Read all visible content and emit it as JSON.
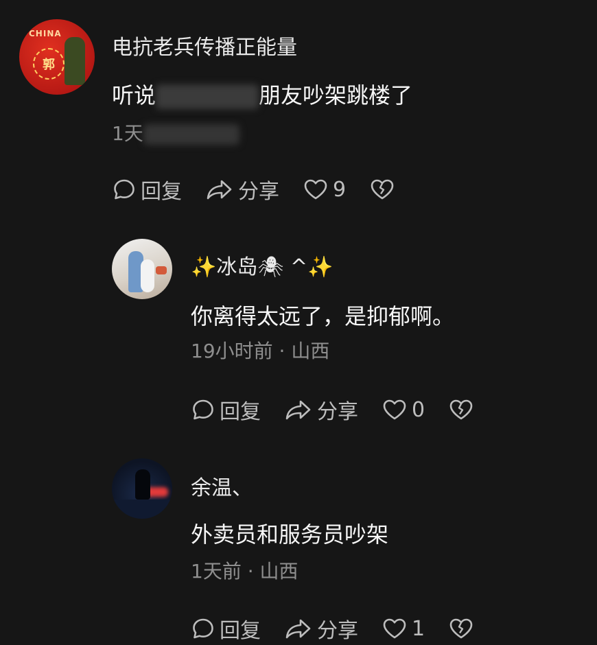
{
  "actions": {
    "reply": "回复",
    "share": "分享"
  },
  "comments": [
    {
      "username": "电抗老兵传播正能量",
      "text_start": "听说",
      "text_end": "朋友吵架跳楼了",
      "meta_start": "1天",
      "likes": "9",
      "avatar_text": "郭",
      "avatar_banner": "CHINA"
    },
    {
      "username": "✨冰岛🕷 ^✨",
      "text": "你离得太远了，是抑郁啊。",
      "meta": "19小时前 · 山西",
      "likes": "0"
    },
    {
      "username": "余温、",
      "text": "外卖员和服务员吵架",
      "meta": "1天前 · 山西",
      "likes": "1"
    }
  ]
}
